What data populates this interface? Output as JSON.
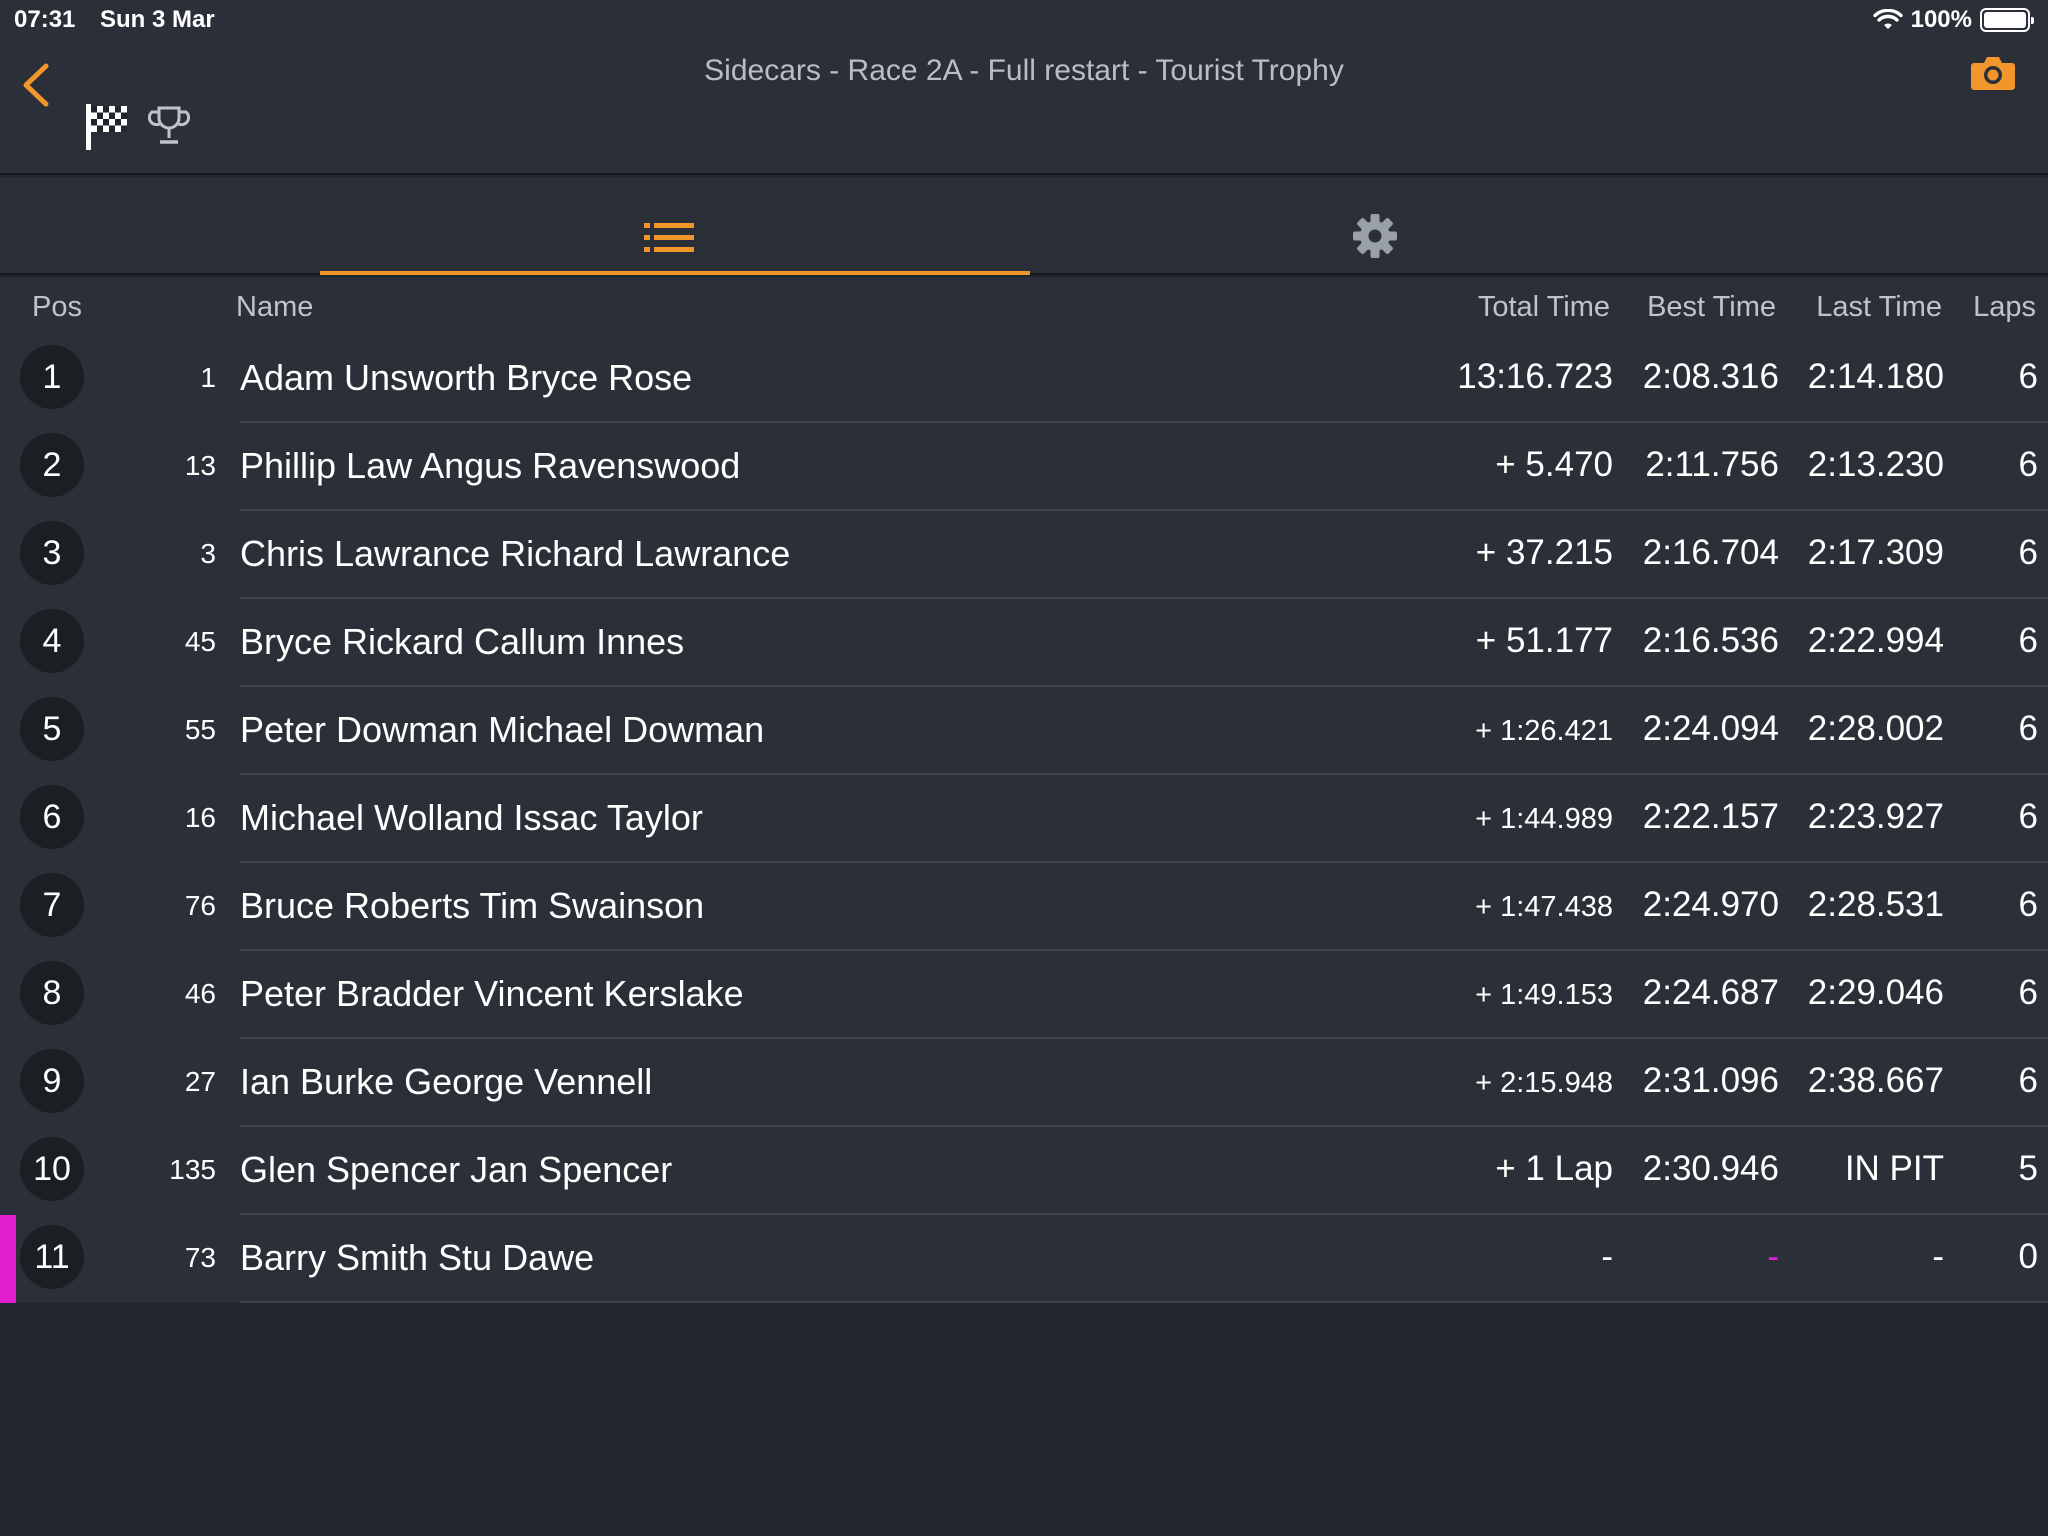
{
  "status_bar": {
    "time": "07:31",
    "date": "Sun 3 Mar",
    "battery": "100%"
  },
  "header": {
    "title": "Sidecars - Race 2A - Full restart - Tourist Trophy"
  },
  "colors": {
    "accent": "#f0962a",
    "highlight": "#e01fd1",
    "background": "#21252c",
    "panel": "#2b3038"
  },
  "table": {
    "columns": {
      "pos": "Pos",
      "name": "Name",
      "total": "Total Time",
      "best": "Best Time",
      "last": "Last Time",
      "laps": "Laps"
    },
    "rows": [
      {
        "pos": "1",
        "num": "1",
        "name": "Adam Unsworth Bryce Rose",
        "total": "13:16.723",
        "best": "2:08.316",
        "last": "2:14.180",
        "laps": "6"
      },
      {
        "pos": "2",
        "num": "13",
        "name": "Phillip Law Angus Ravenswood",
        "total": "+ 5.470",
        "best": "2:11.756",
        "last": "2:13.230",
        "laps": "6"
      },
      {
        "pos": "3",
        "num": "3",
        "name": "Chris Lawrance Richard Lawrance",
        "total": "+ 37.215",
        "best": "2:16.704",
        "last": "2:17.309",
        "laps": "6"
      },
      {
        "pos": "4",
        "num": "45",
        "name": "Bryce Rickard Callum Innes",
        "total": "+ 51.177",
        "best": "2:16.536",
        "last": "2:22.994",
        "laps": "6"
      },
      {
        "pos": "5",
        "num": "55",
        "name": "Peter Dowman Michael Dowman",
        "total": "+ 1:26.421",
        "best": "2:24.094",
        "last": "2:28.002",
        "laps": "6"
      },
      {
        "pos": "6",
        "num": "16",
        "name": "Michael Wolland Issac Taylor",
        "total": "+ 1:44.989",
        "best": "2:22.157",
        "last": "2:23.927",
        "laps": "6"
      },
      {
        "pos": "7",
        "num": "76",
        "name": "Bruce Roberts Tim Swainson",
        "total": "+ 1:47.438",
        "best": "2:24.970",
        "last": "2:28.531",
        "laps": "6"
      },
      {
        "pos": "8",
        "num": "46",
        "name": "Peter Bradder Vincent Kerslake",
        "total": "+ 1:49.153",
        "best": "2:24.687",
        "last": "2:29.046",
        "laps": "6"
      },
      {
        "pos": "9",
        "num": "27",
        "name": "Ian Burke George Vennell",
        "total": "+ 2:15.948",
        "best": "2:31.096",
        "last": "2:38.667",
        "laps": "6"
      },
      {
        "pos": "10",
        "num": "135",
        "name": "Glen Spencer Jan Spencer",
        "total": "+ 1 Lap",
        "best": "2:30.946",
        "last": "IN PIT",
        "laps": "5"
      },
      {
        "pos": "11",
        "num": "73",
        "name": "Barry Smith Stu Dawe",
        "total": "-",
        "best": "-",
        "last": "-",
        "laps": "0"
      }
    ]
  }
}
